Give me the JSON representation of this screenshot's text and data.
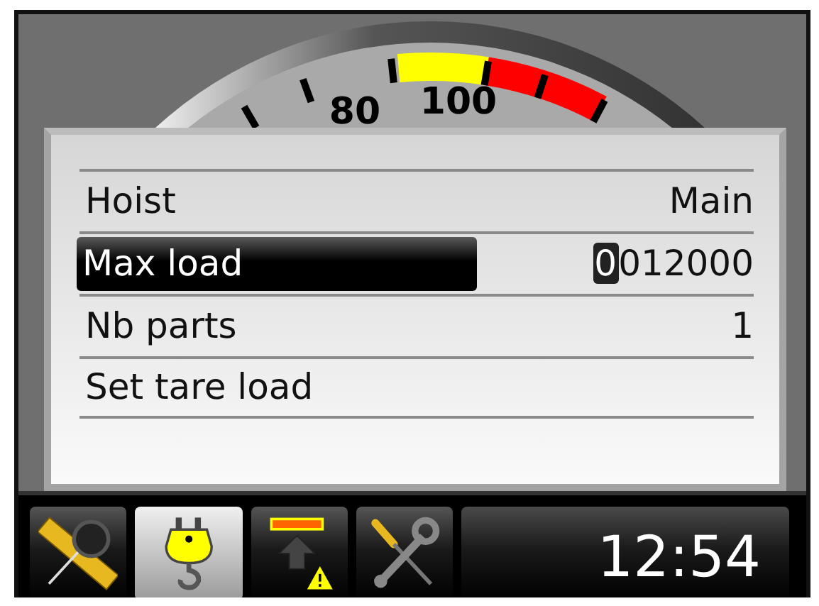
{
  "gauge": {
    "tick_labels": [
      "80",
      "100"
    ]
  },
  "menu": {
    "editing": true,
    "rows": [
      {
        "label": "Hoist",
        "value": "Main",
        "selected": false
      },
      {
        "label": "Max load",
        "value": "0012000",
        "selected": true
      },
      {
        "label": "Nb parts",
        "value": "1",
        "selected": false
      },
      {
        "label": "Set tare load",
        "selected": false
      }
    ]
  },
  "toolbar": {
    "buttons": [
      {
        "kind": "measure",
        "selected": false
      },
      {
        "kind": "hook",
        "selected": true
      },
      {
        "kind": "tare",
        "selected": false
      },
      {
        "kind": "tools",
        "selected": false
      }
    ],
    "clock": "12:54"
  }
}
